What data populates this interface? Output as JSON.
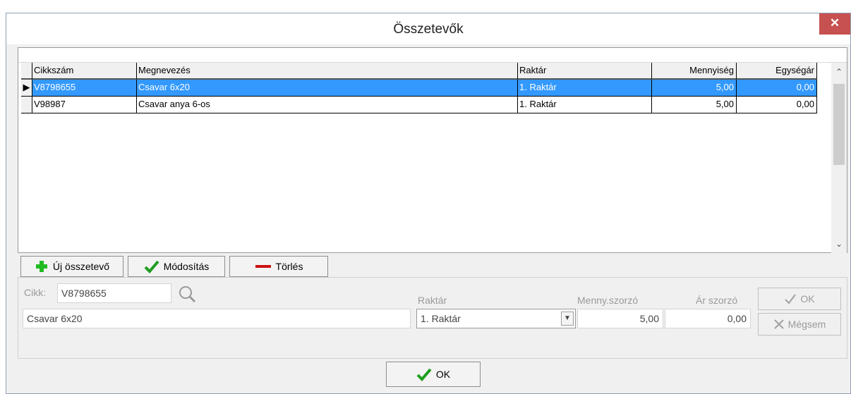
{
  "window": {
    "title": "Összetevők",
    "close": "✕"
  },
  "grid": {
    "columns": [
      "Cikkszám",
      "Megnevezés",
      "Raktár",
      "Mennyiség",
      "Egységár"
    ],
    "rows": [
      {
        "indicator": "▶",
        "cikkszam": "V8798655",
        "megnevezes": "Csavar 6x20",
        "raktar": "1. Raktár",
        "mennyiseg": "5,00",
        "egysegar": "0,00"
      },
      {
        "indicator": "",
        "cikkszam": "V98987",
        "megnevezes": "Csavar anya 6-os",
        "raktar": "1. Raktár",
        "mennyiseg": "5,00",
        "egysegar": "0,00"
      }
    ],
    "scroll_up": "⌃",
    "scroll_down": "⌄"
  },
  "toolbar": {
    "new_label": "Új összetevő",
    "edit_label": "Módosítás",
    "delete_label": "Törlés"
  },
  "editor": {
    "cikk_label": "Cikk:",
    "cikk_value": "V8798655",
    "name_value": "Csavar 6x20",
    "raktar_label": "Raktár",
    "raktar_value": "1. Raktár",
    "menny_label": "Menny.szorzó",
    "menny_value": "5,00",
    "ar_label": "Ár szorzó",
    "ar_value": "0,00",
    "ok_label": "OK",
    "cancel_label": "Mégsem"
  },
  "footer": {
    "ok_label": "OK"
  },
  "colors": {
    "selection": "#3399ff",
    "close": "#c75050",
    "add": "#22bb22",
    "check": "#1e9e1e",
    "delete": "#cc1111"
  },
  "icons": [
    "close-icon",
    "row-pointer-icon",
    "plus-icon",
    "checkmark-icon",
    "minus-icon",
    "search-icon",
    "dropdown-arrow-icon",
    "cancel-x-icon"
  ]
}
